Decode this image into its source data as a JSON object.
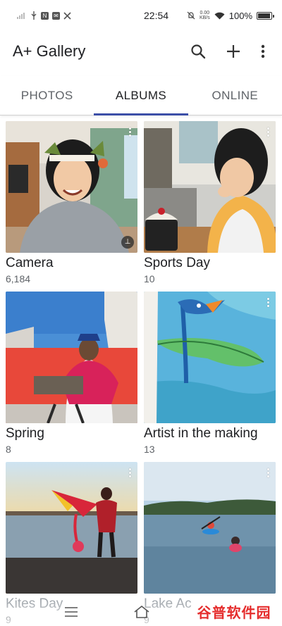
{
  "status_bar": {
    "time": "22:54",
    "net_speed_value": "0.00",
    "net_speed_unit": "KB/s",
    "battery": "100%",
    "battery_level": 1.0
  },
  "app_bar": {
    "title": "A+ Gallery",
    "icons": [
      "search-icon",
      "add-icon",
      "more-vert-icon"
    ]
  },
  "tabs": [
    {
      "label": "PHOTOS",
      "active": false
    },
    {
      "label": "ALBUMS",
      "active": true
    },
    {
      "label": "ONLINE",
      "active": false
    }
  ],
  "albums": [
    {
      "name": "Camera",
      "count": "6,184"
    },
    {
      "name": "Sports Day",
      "count": "10"
    },
    {
      "name": "Spring",
      "count": "8"
    },
    {
      "name": "Artist in the making",
      "count": "13"
    },
    {
      "name": "Kites Day",
      "count": "9"
    },
    {
      "name": "Lake Ac",
      "count": "9"
    }
  ],
  "watermark": "谷普软件园",
  "colors": {
    "tab_indicator": "#3c4fa8",
    "text_primary": "#202124",
    "text_secondary": "#5f6368"
  }
}
